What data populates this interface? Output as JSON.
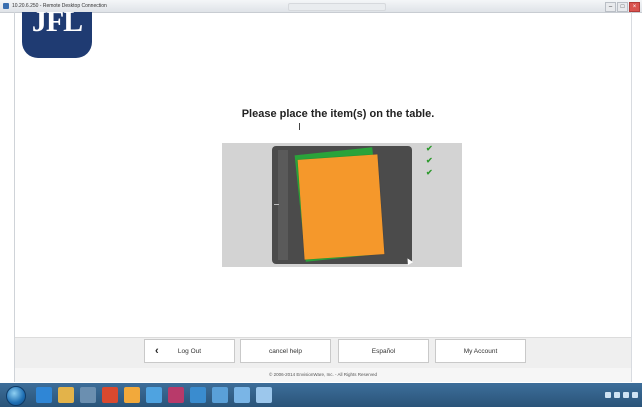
{
  "window": {
    "title": "10.20.6.250 - Remote Desktop Connection",
    "controls": {
      "minimize": "–",
      "maximize": "□",
      "close": "×"
    }
  },
  "logo": {
    "text": "JFL"
  },
  "main": {
    "instruction": "Please place the item(s) on the table.",
    "checks": [
      "✔",
      "✔",
      "✔"
    ]
  },
  "nav": {
    "logout_label": "Log Out",
    "back_icon": "‹",
    "cancel_help_label": "cancel help",
    "espanol_label": "Español",
    "account_label": "My Account"
  },
  "footer": {
    "text": "© 2006-2014 EnvisionWare, Inc. - All Rights Reserved"
  },
  "colors": {
    "logo": "#1f3b72",
    "item_front": "#f5982b",
    "item_middle": "#2aa33a",
    "item_back": "#2d6fc4",
    "check": "#2e9a2e"
  }
}
